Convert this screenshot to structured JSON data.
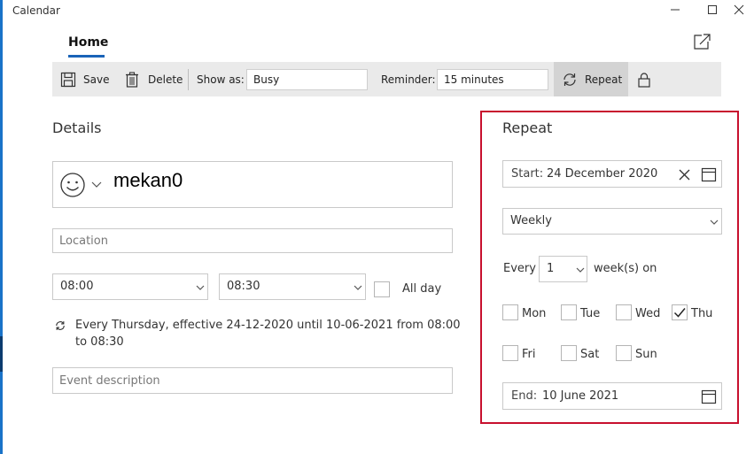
{
  "window": {
    "title": "Calendar"
  },
  "tabs": {
    "home": "Home"
  },
  "toolbar": {
    "save": "Save",
    "delete": "Delete",
    "show_as_label": "Show as:",
    "show_as_value": "Busy",
    "reminder_label": "Reminder:",
    "reminder_value": "15 minutes",
    "repeat": "Repeat"
  },
  "details": {
    "heading": "Details",
    "title_value": "mekan0",
    "location_placeholder": "Location",
    "start_time": "08:00",
    "end_time": "08:30",
    "all_day_label": "All day",
    "recurrence_line1": "Every Thursday, effective 24-12-2020 until 10-06-2021 from 08:00",
    "recurrence_line2": "to 08:30",
    "description_placeholder": "Event description"
  },
  "repeat_panel": {
    "heading": "Repeat",
    "start_label": "Start:",
    "start_value": "24 December 2020",
    "frequency": "Weekly",
    "every_label": "Every",
    "every_value": "1",
    "unit_label": "week(s) on",
    "days": [
      {
        "label": "Mon",
        "checked": false
      },
      {
        "label": "Tue",
        "checked": false
      },
      {
        "label": "Wed",
        "checked": false
      },
      {
        "label": "Thu",
        "checked": true
      },
      {
        "label": "Fri",
        "checked": false
      },
      {
        "label": "Sat",
        "checked": false
      },
      {
        "label": "Sun",
        "checked": false
      }
    ],
    "end_label": "End:",
    "end_value": "10 June 2021"
  },
  "colors": {
    "accent": "#1a63b8",
    "highlight_border": "#c8102e"
  }
}
